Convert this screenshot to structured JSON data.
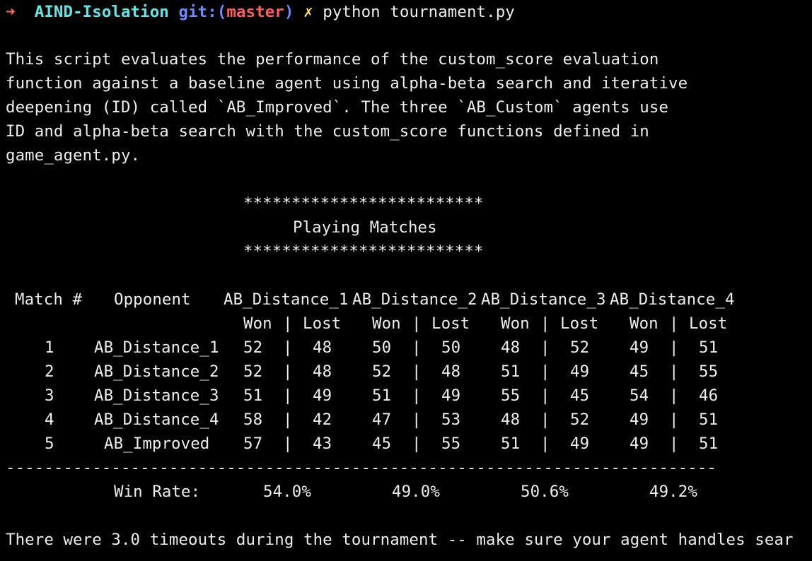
{
  "prompt": {
    "arrow": "➜",
    "directory": "AIND-Isolation",
    "git_prefix": "git:(",
    "branch": "master",
    "git_suffix": ")",
    "dirty_marker": "✗",
    "command": "python tournament.py"
  },
  "intro": [
    "This script evaluates the performance of the custom_score evaluation",
    "function against a baseline agent using alpha-beta search and iterative",
    "deepening (ID) called `AB_Improved`. The three `AB_Custom` agents use",
    "ID and alpha-beta search with the custom_score functions defined in",
    "game_agent.py."
  ],
  "banner": {
    "stars": "*************************",
    "title": "Playing Matches"
  },
  "table": {
    "header_match": "Match #",
    "header_opponent": "Opponent",
    "agents": [
      "AB_Distance_1",
      "AB_Distance_2",
      "AB_Distance_3",
      "AB_Distance_4"
    ],
    "sub_won": "Won",
    "sub_sep": "|",
    "sub_lost": "Lost",
    "rows": [
      {
        "match": "1",
        "opponent": "AB_Distance_1",
        "results": [
          [
            "52",
            "48"
          ],
          [
            "50",
            "50"
          ],
          [
            "48",
            "52"
          ],
          [
            "49",
            "51"
          ]
        ]
      },
      {
        "match": "2",
        "opponent": "AB_Distance_2",
        "results": [
          [
            "52",
            "48"
          ],
          [
            "52",
            "48"
          ],
          [
            "51",
            "49"
          ],
          [
            "45",
            "55"
          ]
        ]
      },
      {
        "match": "3",
        "opponent": "AB_Distance_3",
        "results": [
          [
            "51",
            "49"
          ],
          [
            "51",
            "49"
          ],
          [
            "55",
            "45"
          ],
          [
            "54",
            "46"
          ]
        ]
      },
      {
        "match": "4",
        "opponent": "AB_Distance_4",
        "results": [
          [
            "58",
            "42"
          ],
          [
            "47",
            "53"
          ],
          [
            "48",
            "52"
          ],
          [
            "49",
            "51"
          ]
        ]
      },
      {
        "match": "5",
        "opponent": "AB_Improved",
        "results": [
          [
            "57",
            "43"
          ],
          [
            "45",
            "55"
          ],
          [
            "51",
            "49"
          ],
          [
            "49",
            "51"
          ]
        ]
      }
    ],
    "divider": "--------------------------------------------------------------------------",
    "win_rate_label": "Win Rate:",
    "win_rates": [
      "54.0%",
      "49.0%",
      "50.6%",
      "49.2%"
    ]
  },
  "footer": "There were 3.0 timeouts during the tournament -- make sure your agent handles sear"
}
